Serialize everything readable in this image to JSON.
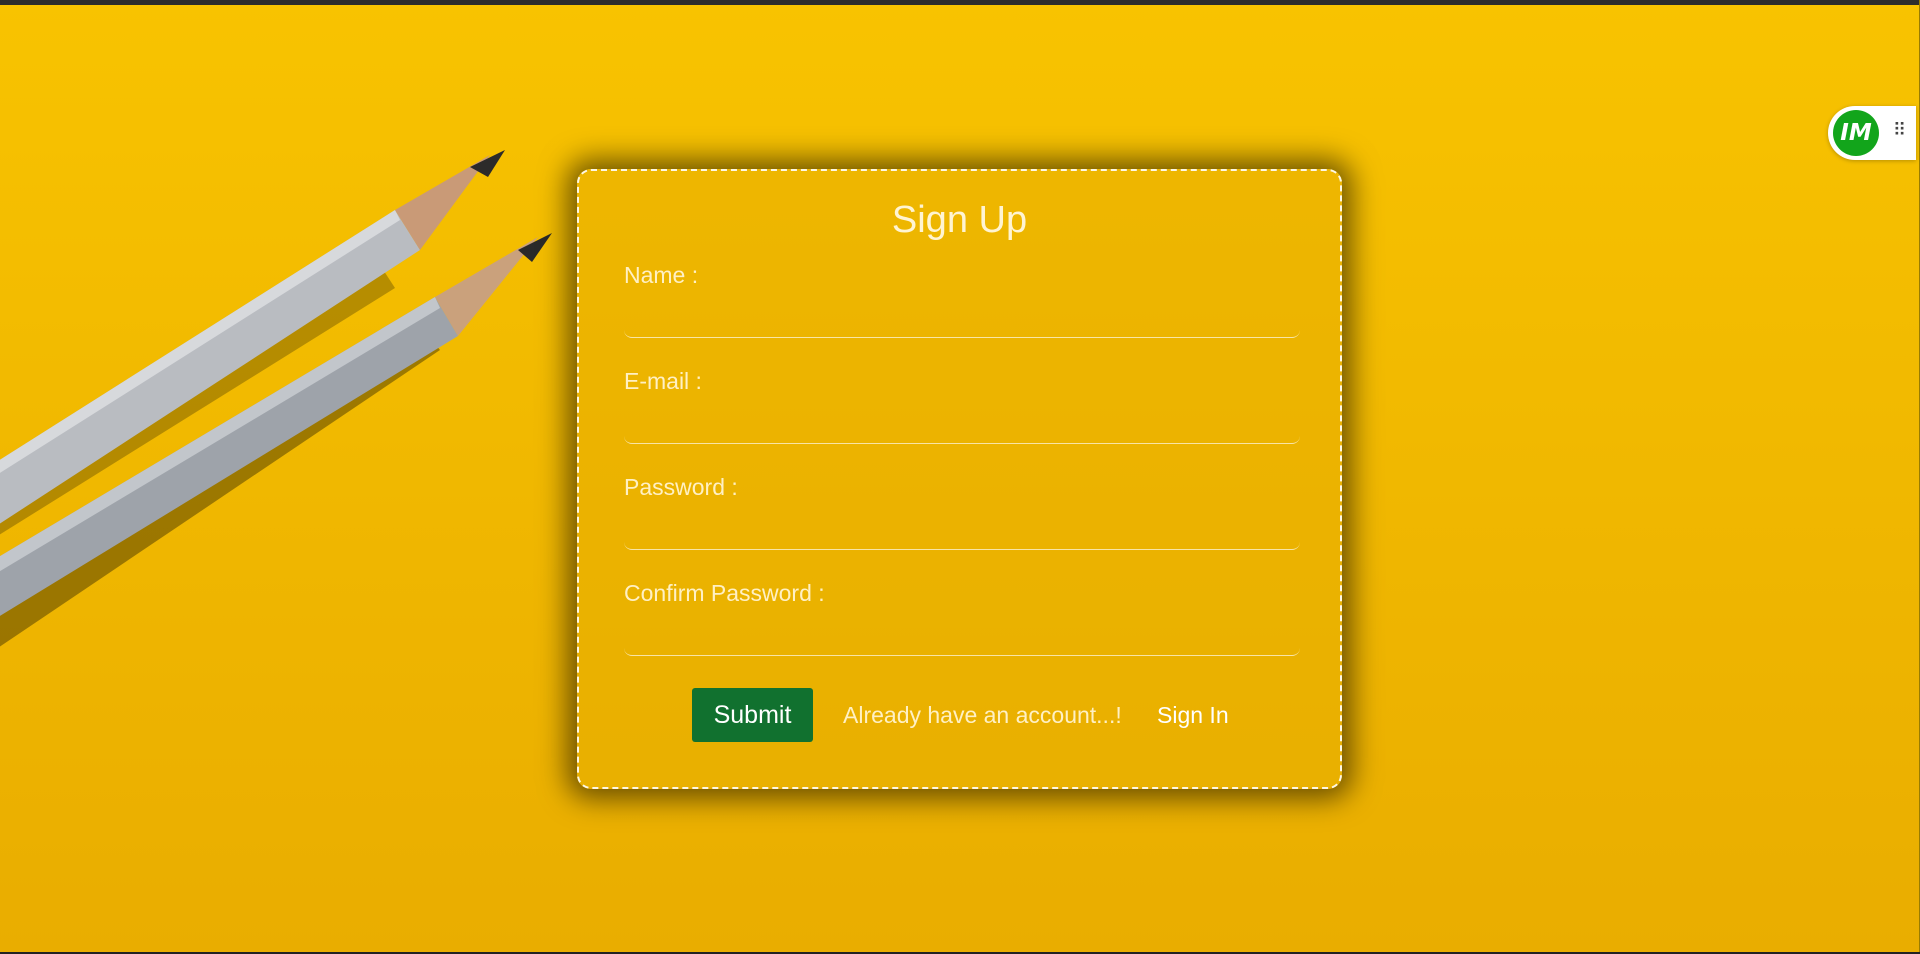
{
  "form": {
    "title": "Sign Up",
    "fields": [
      {
        "label": "Name :",
        "value": ""
      },
      {
        "label": "E-mail :",
        "value": ""
      },
      {
        "label": "Password :",
        "value": ""
      },
      {
        "label": "Confirm Password :",
        "value": ""
      }
    ],
    "submit_label": "Submit",
    "already_text": "Already have an account...!",
    "signin_label": "Sign In"
  },
  "extension": {
    "logo_text": "IM",
    "grip": "⠿"
  },
  "colors": {
    "background": "#f1b900",
    "submit_button": "#11712f",
    "extension_logo": "#12a51b"
  },
  "icons": {
    "extension_logo": "im-logo-icon",
    "grip": "drag-handle-icon"
  }
}
